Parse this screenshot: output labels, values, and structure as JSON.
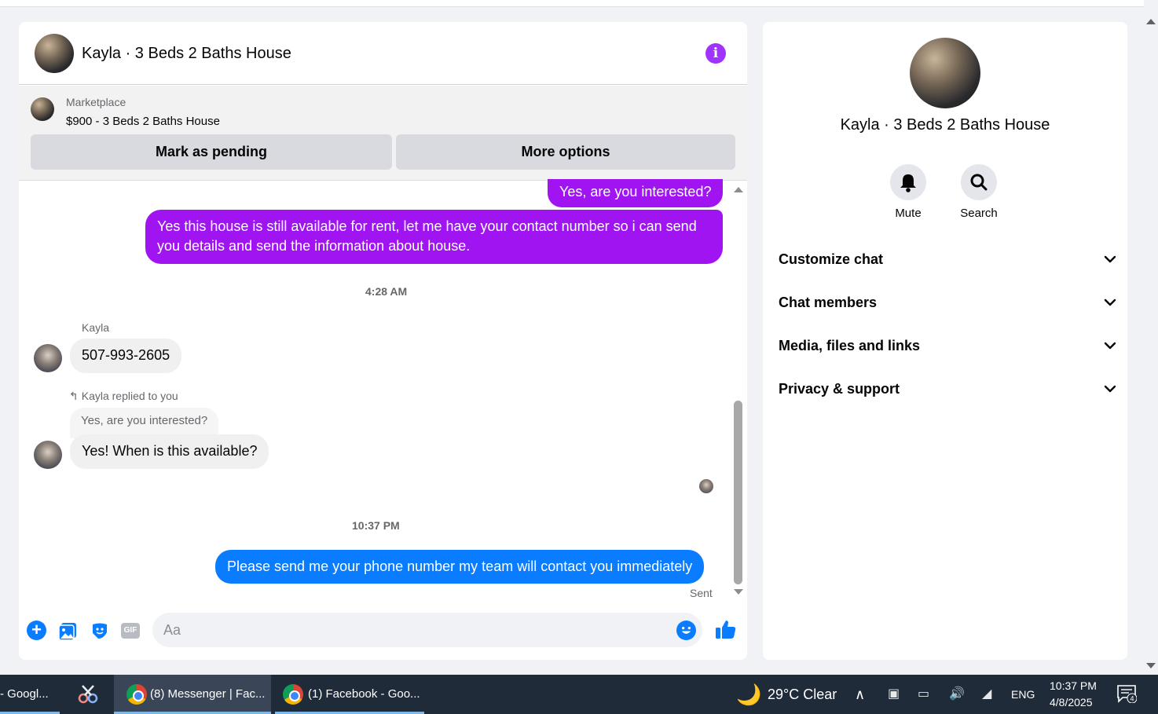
{
  "colors": {
    "accent_purple": "#a033ff",
    "bubble_purple": "#a114f2",
    "bubble_blue": "#0a7cff",
    "taskbar": "#202b3a"
  },
  "chat": {
    "title": "Kayla · 3 Beds 2 Baths House",
    "info_icon": "info-icon",
    "listing": {
      "label": "Marketplace",
      "title": "$900 - 3 Beds 2 Baths House",
      "mark_pending": "Mark as pending",
      "more_options": "More options"
    },
    "messages": {
      "m1": "Yes, are you interested?",
      "m2": "Yes this house is still available for rent, let me have your contact number so i can send you details and send the information about house.",
      "time1": "4:28 AM",
      "sender": "Kayla",
      "m3": "507-993-2605",
      "reply_label": "Kayla replied to you",
      "quoted": "Yes, are you interested?",
      "m4": "Yes! When is this available?",
      "time2": "10:37 PM",
      "m5": "Please send me your phone number my team will contact you immediately",
      "status": "Sent"
    },
    "composer": {
      "placeholder": "Aa",
      "gif_label": "GIF"
    }
  },
  "info_panel": {
    "title": "Kayla · 3 Beds 2 Baths House",
    "actions": {
      "mute": "Mute",
      "search": "Search"
    },
    "sections": {
      "customize": "Customize chat",
      "members": "Chat members",
      "media": "Media, files and links",
      "privacy": "Privacy & support"
    }
  },
  "taskbar": {
    "task1": "- Googl...",
    "task3": "(8) Messenger | Fac...",
    "task4": "(1) Facebook - Goo...",
    "weather": "29°C  Clear",
    "lang": "ENG",
    "time": "10:37 PM",
    "date": "4/8/2025",
    "notif_count": "4"
  }
}
